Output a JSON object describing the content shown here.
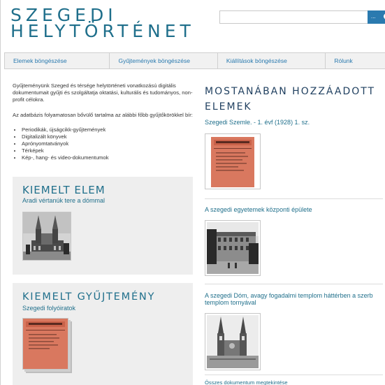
{
  "header": {
    "title_line1": "SZEGEDI",
    "title_line2": "HELYTÖRTÉNET",
    "search": {
      "placeholder": "",
      "button_label": "..."
    }
  },
  "nav": {
    "items": [
      {
        "label": "Elemek böngészése"
      },
      {
        "label": "Gyűjtemények böngészése"
      },
      {
        "label": "Kiállítások böngészése"
      },
      {
        "label": "Rólunk"
      }
    ]
  },
  "intro": {
    "paragraph1": "Gyűjteményünk Szeged és térsége helytörténeti vonatkozású digitális dokumentumait gyűjti és szolgáltatja oktatási, kulturális és tudományos, non-profit célokra.",
    "paragraph2": "Az adatbázis folyamatosan bővülő tartalma az alábbi főbb gyűjtőkörökkel bír:",
    "list": [
      "Periodikák, újságcikk-gyűjtemények",
      "Digitalizált könyvek",
      "Aprónyomtatványok",
      "Térképek",
      "Kép-, hang- és video-dokumentumok"
    ]
  },
  "featured_item": {
    "heading": "KIEMELT ELEM",
    "title": "Aradi vértanúk tere a dómmal"
  },
  "featured_collection": {
    "heading": "KIEMELT GYŰJTEMÉNY",
    "title": "Szegedi folyóiratok"
  },
  "recent": {
    "heading_line1": "MOSTANÁBAN HOZZÁADOTT",
    "heading_line2": "ELEMEK",
    "items": [
      {
        "title": "Szegedi Szemle. - 1. évf (1928) 1. sz."
      },
      {
        "title": "A szegedi egyetemek központi épülete"
      },
      {
        "title": "A szegedi Dóm, avagy fogadalmi templom háttérben a szerb templom tornyával"
      }
    ],
    "all_link": "Összes dokumentum megtekintése"
  },
  "colors": {
    "accent": "#1f6f8b",
    "link": "#2a7aaf",
    "nav_bg": "#f1f1f1",
    "box_bg": "#eeeeee",
    "magazine_cover": "#d9785f"
  }
}
